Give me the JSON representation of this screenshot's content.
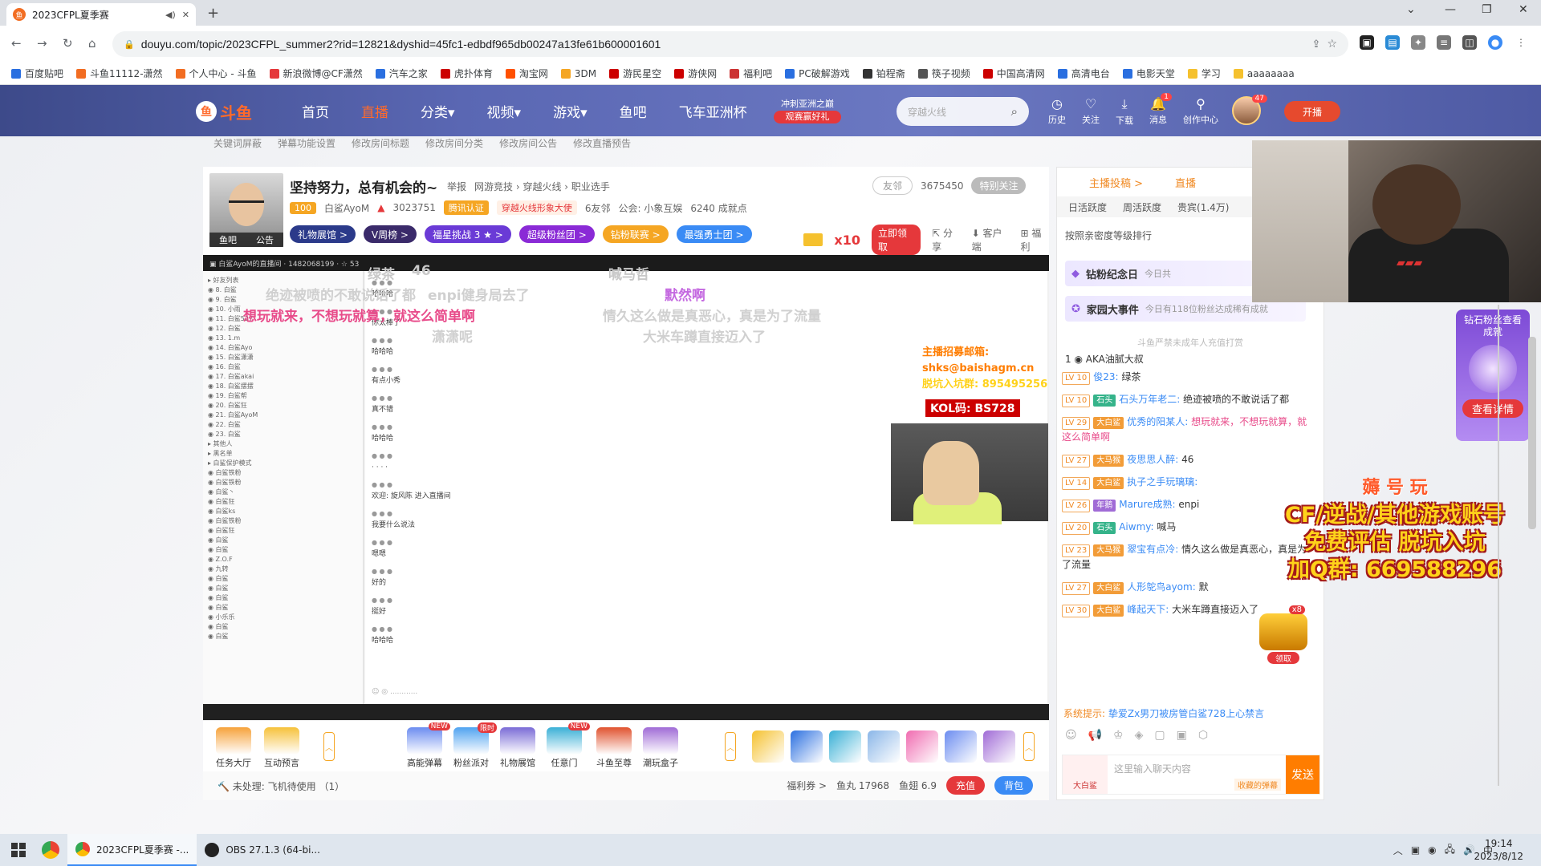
{
  "browser": {
    "tab_title": "2023CFPL夏季赛",
    "url": "douyu.com/topic/2023CFPL_summer2?rid=12821&dyshid=45fc1-edbdf965db00247a13fe61b600001601",
    "bookmarks": [
      "百度贴吧",
      "斗鱼11112-潇然",
      "个人中心 - 斗鱼",
      "新浪微博@CF潇然",
      "汽车之家",
      "虎扑体育",
      "淘宝网",
      "3DM",
      "游民星空",
      "游侠网",
      "福利吧",
      "PC破解游戏",
      "铂程斋",
      "筷子视频",
      "中国高清网",
      "高清电台",
      "电影天堂",
      "学习",
      "aaaaaaaa"
    ]
  },
  "header": {
    "logo": "斗鱼",
    "nav": [
      "首页",
      "直播",
      "分类▾",
      "视频▾",
      "游戏▾",
      "鱼吧",
      "飞车亚洲杯"
    ],
    "promo_top": "冲刺亚洲之巅",
    "promo_bottom": "观赛赢好礼",
    "search_placeholder": "穿越火线",
    "icons": [
      {
        "label": "历史",
        "icon": "clock-icon"
      },
      {
        "label": "关注",
        "icon": "heart-icon"
      },
      {
        "label": "下载",
        "icon": "download-icon"
      },
      {
        "label": "消息",
        "icon": "bell-icon",
        "badge": "1"
      },
      {
        "label": "创作中心",
        "icon": "pin-icon"
      }
    ],
    "avatar_badge": "47",
    "kaibo": "开播"
  },
  "admin_links": [
    "关键词屏蔽",
    "弹幕功能设置",
    "修改房间标题",
    "修改房间分类",
    "修改房间公告",
    "修改直播预告"
  ],
  "room": {
    "title": "坚持努力，总有机会的~",
    "report": "举报",
    "category": "网游竞技 › 穿越火线 › 职业选手",
    "avatar_tabs": [
      "鱼吧",
      "公告"
    ],
    "level": "100",
    "streamer": "白鲨AyoM",
    "hot": "3023751",
    "cert": "腾讯认证",
    "ambassador": "穿越火线形象大使",
    "friends": "6友邻",
    "guild": "公会: 小象互娱",
    "achievements": "6240 成就点",
    "follow_btn": "友邻",
    "follow_count": "3675450",
    "special_follow": "特别关注",
    "pills": [
      "礼物展馆 >",
      "V周榜 >",
      "福星挑战 3 ★ >",
      "超级粉丝团 >",
      "钻粉联赛 >",
      "最强勇士团 >"
    ],
    "x10": "x10",
    "claim": "立即领取",
    "actions": [
      "分享",
      "客户端",
      "福利"
    ]
  },
  "video": {
    "overlays": [
      {
        "text": "绿茶",
        "color": "#c8c8c8"
      },
      {
        "text": "46",
        "color": "#c8c8c8"
      },
      {
        "text": "喊马哲",
        "color": "#c8c8c8"
      },
      {
        "text": "绝迹被喷的不敢说话了都",
        "color": "#d0d0d0"
      },
      {
        "text": "enpi健身局去了",
        "color": "#d0d0d0"
      },
      {
        "text": "默然啊",
        "color": "#c468e0"
      },
      {
        "text": "想玩就来，不想玩就算，就这么简单啊",
        "color": "#e84b8a"
      },
      {
        "text": "情久这么做是真恶心，真是为了流量",
        "color": "#d0d0d0"
      },
      {
        "text": "潇潇呢",
        "color": "#d0d0d0"
      },
      {
        "text": "大米车蹲直接迈入了",
        "color": "#d0d0d0"
      }
    ],
    "ad_email": "主播招募邮箱: shks@baishagm.cn",
    "ad_group": "脱坑入坑群: 895495256",
    "kol": "KOL码: BS728",
    "chat_lines": [
      "哈哈哈",
      "你太棒了",
      "哈哈哈",
      "有点小秀",
      "真不错",
      "哈哈哈",
      "· · · ·",
      "欢迎: 旋风陈 进入直播间",
      "我要什么说法",
      "嗯嗯",
      "好的",
      "挺好",
      "哈哈哈"
    ]
  },
  "gifts": [
    {
      "label": "任务大厅",
      "color": "#f6a23a"
    },
    {
      "label": "互动预言",
      "color": "#f6c13a"
    },
    {
      "label": "高能弹幕",
      "color": "#6b8cf0",
      "badge": "NEW"
    },
    {
      "label": "粉丝派对",
      "color": "#4fa3f0",
      "badge": "限时"
    },
    {
      "label": "礼物展馆",
      "color": "#7a6bd6"
    },
    {
      "label": "任意门",
      "color": "#3ab0d6",
      "badge": "NEW"
    },
    {
      "label": "斗鱼至尊",
      "color": "#e0522e"
    },
    {
      "label": "潮玩盒子",
      "color": "#a06bd6"
    }
  ],
  "gift_icons": [
    "gold",
    "blue-rocket",
    "cyan-plane",
    "white-jet",
    "pink-box",
    "blue-box",
    "purple-box"
  ],
  "bottom": {
    "pending": "未处理: 飞机待使用 （1）",
    "welfare": "福利券 >",
    "fishball": "鱼丸 17968",
    "fishwing": "鱼翅 6.9",
    "recharge": "充值",
    "bag": "背包"
  },
  "rpanel": {
    "tabs": [
      "主播投稿 >",
      "直播"
    ],
    "rank_tabs": [
      "日活跃度",
      "周活跃度",
      "贵宾(1.4万)"
    ],
    "sort": "按照亲密度等级排行",
    "diamond": "钻粉纪念日",
    "diamond_sub": "今日共",
    "campus": "家园大事件",
    "campus_sub": "今日有118位粉丝达成稀有成就",
    "notice": "斗鱼严禁未成年人充值打赏",
    "top_fan": "AKA油腻大叔",
    "chat": [
      {
        "lv": "LV 10",
        "medal": "",
        "name": "俊23:",
        "msg": "绿茶",
        "pink": false
      },
      {
        "lv": "LV 10",
        "medal": "石头",
        "name": "石头万年老二:",
        "msg": "绝迹被喷的不敢说话了都",
        "pink": false
      },
      {
        "lv": "LV 29",
        "medal": "大白鲨",
        "name": "优秀的阳某人:",
        "msg": "想玩就来，不想玩就算，就这么简单啊",
        "pink": true
      },
      {
        "lv": "LV 27",
        "medal": "大马猴",
        "name": "夜思思人醉:",
        "msg": "46",
        "pink": false
      },
      {
        "lv": "LV 14",
        "medal": "大白鲨",
        "name": "执子之手玩璃璃:",
        "msg": "",
        "pink": false
      },
      {
        "lv": "LV 26",
        "medal": "年鹅",
        "name": "Marure成熟:",
        "msg": "enpi",
        "pink": false
      },
      {
        "lv": "LV 20",
        "medal": "石头",
        "name": "Aiwmy:",
        "msg": "喊马",
        "pink": false
      },
      {
        "lv": "LV 23",
        "medal": "大马猴",
        "name": "翠宝有点冷:",
        "msg": "情久这么做是真恶心，真是为了流量",
        "pink": false
      },
      {
        "lv": "LV 27",
        "medal": "大白鲨",
        "name": "人形鸵鸟ayom:",
        "msg": "默",
        "pink": false
      },
      {
        "lv": "LV 30",
        "medal": "大白鲨",
        "name": "峰起天下:",
        "msg": "大米车蹲直接迈入了",
        "pink": false
      }
    ],
    "system_label": "系统提示:",
    "system_msg": "挚爱Zx男刀被房管白鲨728上心禁言",
    "input_placeholder": "这里输入聊天内容",
    "input_tag": "收藏的弹幕",
    "input_badge": "大白鲨",
    "send": "发送"
  },
  "side": {
    "ad_title": "钻石粉丝查看成就",
    "ad_btn": "查看详情",
    "big_ad_1": "薅 号 玩",
    "big_ad_2": "CF/逆战/其他游戏账号",
    "big_ad_3": "免费评估  脱坑入坑",
    "big_ad_4": "加Q群: 669588296",
    "treasure_count": "x8",
    "treasure_label": "领取"
  },
  "taskbar": {
    "items": [
      "2023CFPL夏季赛 -...",
      "OBS 27.1.3 (64-bi..."
    ],
    "time": "19:14",
    "date": "2023/8/12"
  }
}
